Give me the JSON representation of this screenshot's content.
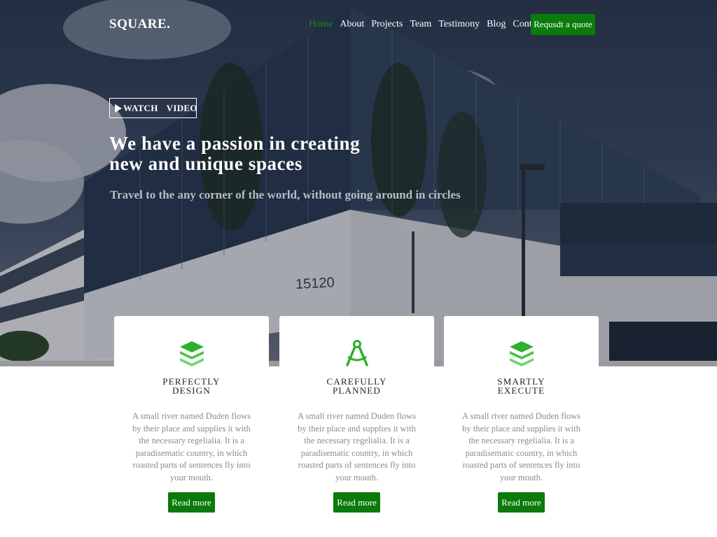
{
  "brand": {
    "name": "SQUARE."
  },
  "nav": {
    "items": [
      {
        "label": "Home",
        "active": true
      },
      {
        "label": "About",
        "active": false
      },
      {
        "label": "Projects",
        "active": false
      },
      {
        "label": "Team",
        "active": false
      },
      {
        "label": "Testimony",
        "active": false
      },
      {
        "label": "Blog",
        "active": false
      },
      {
        "label": "Contact",
        "active": false
      }
    ],
    "cta_label": "Requsdt a quote"
  },
  "hero": {
    "watch_label_1": "WATCH",
    "watch_label_2": "VIDEO",
    "play_icon": "play-icon",
    "headline_line1": "We have a passion in creating",
    "headline_line2": "new and unique spaces",
    "subline": "Travel to the any corner of the world, without going around in circles",
    "building_number": "15120"
  },
  "features": [
    {
      "icon": "layers-icon",
      "title_line1": "Perfectly",
      "title_line2": "Design",
      "description": "A small river named Duden flows by their place and supplies it with the necessary regelialia. It is a paradisematic country, in which roasted parts of sentences fly into your mouth.",
      "button": "Read more"
    },
    {
      "icon": "drafting-compass-icon",
      "title_line1": "Carefully",
      "title_line2": "Planned",
      "description": "A small river named Duden flows by their place and supplies it with the necessary regelialia. It is a paradisematic country, in which roasted parts of sentences fly into your mouth.",
      "button": "Read more"
    },
    {
      "icon": "layers-icon",
      "title_line1": "Smartly",
      "title_line2": "Execute",
      "description": "A small river named Duden flows by their place and supplies it with the necessary regelialia. It is a paradisematic country, in which roasted parts of sentences fly into your mouth.",
      "button": "Read more"
    }
  ],
  "colors": {
    "accent": "#0a7a0a",
    "active_nav": "#1a8a1a",
    "icon_green": "#2fae2f"
  }
}
